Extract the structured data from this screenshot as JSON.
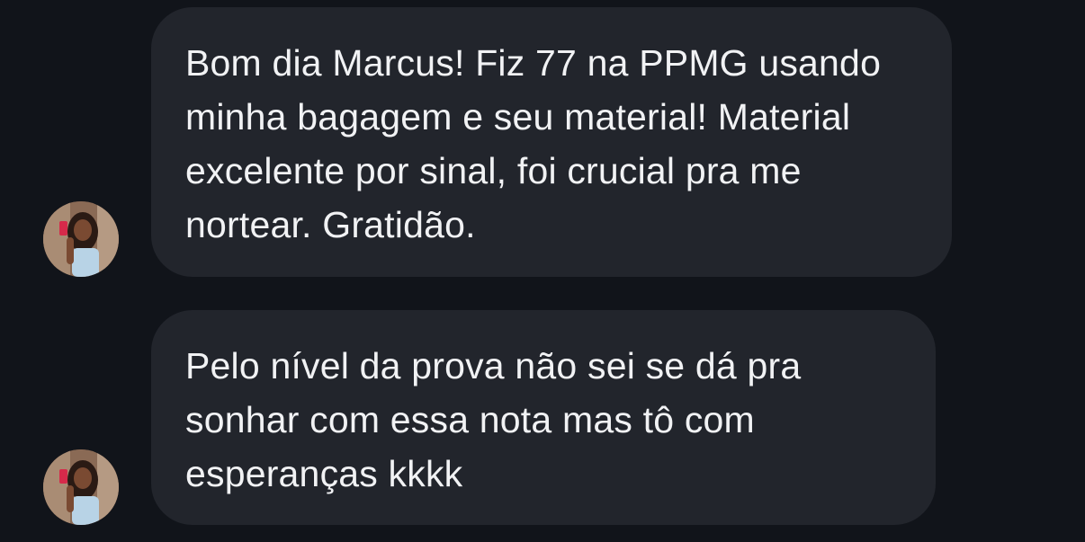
{
  "messages": [
    {
      "sender_avatar": "profile-photo",
      "text": "Bom dia Marcus! Fiz 77 na PPMG usando minha bagagem e seu material! Material excelente por sinal, foi crucial pra me nortear. Gratidão."
    },
    {
      "sender_avatar": "profile-photo",
      "text": "Pelo nível da prova não sei se dá pra sonhar com essa nota mas tô com esperanças kkkk"
    }
  ],
  "colors": {
    "background": "#11141a",
    "bubble": "#22252c",
    "text": "#f1f2f4"
  }
}
